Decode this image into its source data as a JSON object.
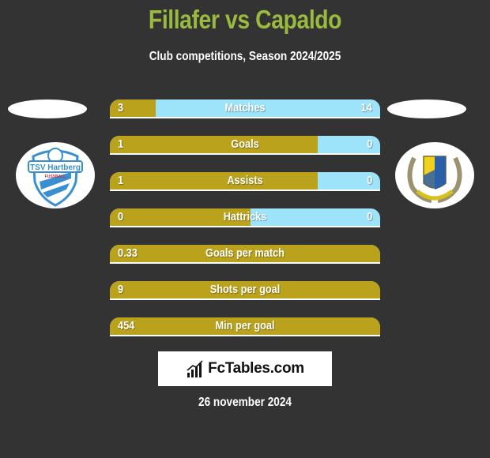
{
  "header": {
    "title": "Fillafer vs Capaldo",
    "subtitle": "Club competitions, Season 2024/2025"
  },
  "teams": {
    "left": {
      "name": "TSV Hartberg",
      "logo_text": "TSV Hartberg",
      "logo_subtext": "FUSSBALL"
    },
    "right": {
      "name": "Capaldo club crest"
    }
  },
  "colors": {
    "title": "#9ab93f",
    "left_bar": "#bba21d",
    "right_bar": "#9de4fa",
    "background": "#333333"
  },
  "stats": [
    {
      "label": "Matches",
      "left": "3",
      "right": "14",
      "left_fraction": 0.17
    },
    {
      "label": "Goals",
      "left": "1",
      "right": "0",
      "left_fraction": 0.77
    },
    {
      "label": "Assists",
      "left": "1",
      "right": "0",
      "left_fraction": 0.77
    },
    {
      "label": "Hattricks",
      "left": "0",
      "right": "0",
      "left_fraction": 0.52
    },
    {
      "label": "Goals per match",
      "left": "0.33",
      "right": "",
      "left_fraction": 1.0
    },
    {
      "label": "Shots per goal",
      "left": "9",
      "right": "",
      "left_fraction": 1.0
    },
    {
      "label": "Min per goal",
      "left": "454",
      "right": "",
      "left_fraction": 1.0
    }
  ],
  "brand": {
    "name": "FcTables.com",
    "icon": "bar-chart-trend-icon"
  },
  "date": "26 november 2024"
}
